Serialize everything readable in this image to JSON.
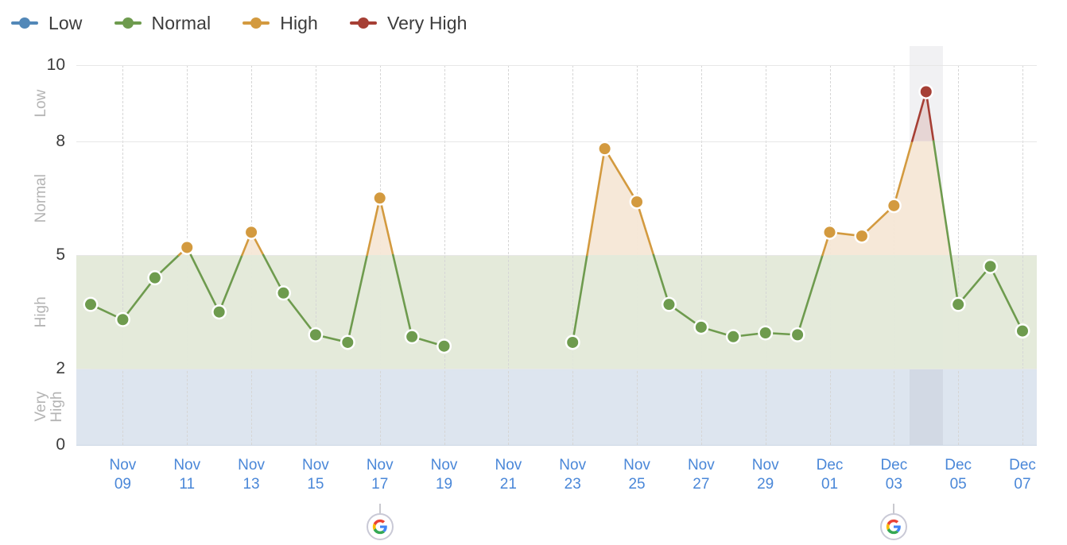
{
  "legend": {
    "items": [
      {
        "label": "Low",
        "color": "#5288b8",
        "icon": "series-marker-icon"
      },
      {
        "label": "Normal",
        "color": "#6e9b4e",
        "icon": "series-marker-icon"
      },
      {
        "label": "High",
        "color": "#d39a3f",
        "icon": "series-marker-icon"
      },
      {
        "label": "Very High",
        "color": "#a63f35",
        "icon": "series-marker-icon"
      }
    ]
  },
  "axes": {
    "y_ticks": [
      "10",
      "8",
      "5",
      "2",
      "0"
    ],
    "y_tick_values": [
      10,
      8,
      5,
      2,
      0
    ],
    "band_labels": [
      "Very\nHigh",
      "High",
      "Normal",
      "Low"
    ],
    "x_tick_labels": [
      "Nov\n09",
      "Nov\n11",
      "Nov\n13",
      "Nov\n15",
      "Nov\n17",
      "Nov\n19",
      "Nov\n21",
      "Nov\n23",
      "Nov\n25",
      "Nov\n27",
      "Nov\n29",
      "Dec\n01",
      "Dec\n03",
      "Dec\n05",
      "Dec\n07"
    ]
  },
  "annotations": {
    "google_updates": [
      {
        "icon": "google-g-icon",
        "date": "Nov 17"
      },
      {
        "icon": "google-g-icon",
        "date": "Dec 03"
      }
    ],
    "highlight_column": {
      "date": "Dec 04"
    }
  },
  "colors": {
    "low": "#5288b8",
    "normal": "#6e9b4e",
    "high": "#d39a3f",
    "very_high": "#a63f35",
    "band_low_fill": "#dde5ef",
    "band_normal_fill": "#e4eada",
    "band_high_fill": "#f6e7d6",
    "band_very_high_fill": "#e5d3d2",
    "x_label": "#4a87d8",
    "grid": "#e7e7e7"
  },
  "chart_data": {
    "type": "area",
    "title": "",
    "xlabel": "",
    "ylabel": "",
    "ylim": [
      0,
      10
    ],
    "yticks": [
      0,
      2,
      5,
      8,
      10
    ],
    "grid": true,
    "legend_position": "top-left",
    "bands": [
      {
        "name": "Low",
        "range": [
          0,
          2
        ],
        "color": "#dde5ef"
      },
      {
        "name": "Normal",
        "range": [
          2,
          5
        ],
        "color": "#e4eada"
      },
      {
        "name": "High",
        "range": [
          5,
          8
        ],
        "color": "#f6e7d6"
      },
      {
        "name": "Very High",
        "range": [
          8,
          10
        ],
        "color": "#e5d3d2"
      }
    ],
    "x": [
      "Nov 08",
      "Nov 09",
      "Nov 10",
      "Nov 11",
      "Nov 12",
      "Nov 13",
      "Nov 14",
      "Nov 15",
      "Nov 16",
      "Nov 17",
      "Nov 18",
      "Nov 19",
      "Nov 20",
      "Nov 21",
      "Nov 22",
      "Nov 23",
      "Nov 24",
      "Nov 25",
      "Nov 26",
      "Nov 27",
      "Nov 28",
      "Nov 29",
      "Nov 30",
      "Dec 01",
      "Dec 02",
      "Dec 03",
      "Dec 04",
      "Dec 05",
      "Dec 06",
      "Dec 07"
    ],
    "values": [
      3.7,
      3.3,
      4.4,
      5.2,
      3.5,
      5.6,
      4.0,
      2.9,
      2.7,
      6.5,
      2.85,
      2.6,
      null,
      null,
      null,
      2.7,
      7.8,
      6.4,
      3.7,
      3.1,
      2.85,
      2.95,
      2.9,
      5.6,
      5.5,
      6.3,
      9.3,
      3.7,
      4.7,
      3.0
    ],
    "point_levels": [
      "Normal",
      "Normal",
      "Normal",
      "High",
      "Normal",
      "High",
      "Normal",
      "Normal",
      "Normal",
      "High",
      "Normal",
      "Normal",
      null,
      null,
      null,
      "Normal",
      "High",
      "High",
      "Normal",
      "Normal",
      "Normal",
      "Normal",
      "Normal",
      "High",
      "High",
      "High",
      "Very High",
      "Normal",
      "Normal",
      "Normal"
    ]
  }
}
